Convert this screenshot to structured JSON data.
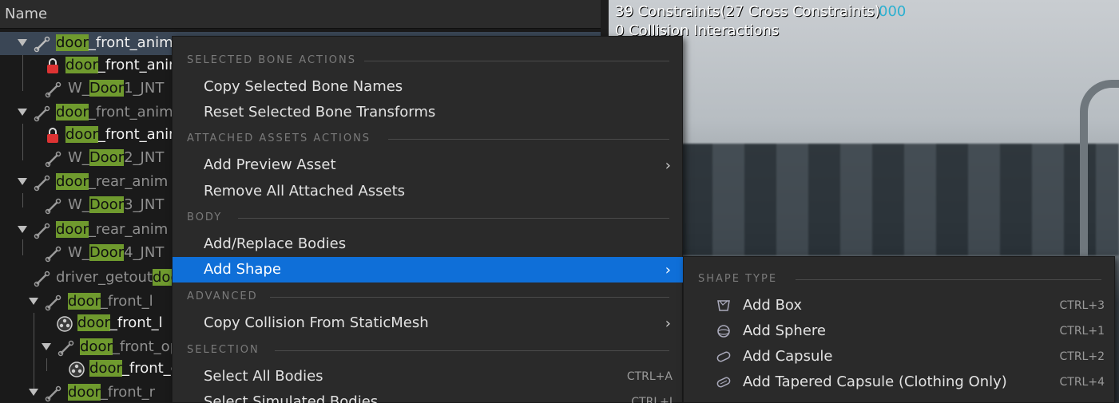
{
  "tree": {
    "header": "Name",
    "rows": [
      {
        "pre": "",
        "hl": "door",
        "post": "_front_anim",
        "icon": "bone-icon"
      },
      {
        "pre": "",
        "hl": "door",
        "post": "_front_anim",
        "icon": "lock-icon"
      },
      {
        "pre": "W_",
        "hl": "Door",
        "post": "1_JNT",
        "icon": "bone-icon"
      },
      {
        "pre": "",
        "hl": "door",
        "post": "_front_anim",
        "icon": "bone-icon"
      },
      {
        "pre": "",
        "hl": "door",
        "post": "_front_anim",
        "icon": "lock-icon"
      },
      {
        "pre": "W_",
        "hl": "Door",
        "post": "2_JNT",
        "icon": "bone-icon"
      },
      {
        "pre": "",
        "hl": "door",
        "post": "_rear_anim",
        "icon": "bone-icon"
      },
      {
        "pre": "W_",
        "hl": "Door",
        "post": "3_JNT",
        "icon": "bone-icon"
      },
      {
        "pre": "",
        "hl": "door",
        "post": "_rear_anim",
        "icon": "bone-icon"
      },
      {
        "pre": "W_",
        "hl": "Door",
        "post": "4_JNT",
        "icon": "bone-icon"
      },
      {
        "pre": "driver_getout",
        "hl": "door",
        "post": "",
        "icon": "bone-icon"
      },
      {
        "pre": "",
        "hl": "door",
        "post": "_front_l",
        "icon": "bone-icon"
      },
      {
        "pre": "",
        "hl": "door",
        "post": "_front_l",
        "icon": "body-icon"
      },
      {
        "pre": "",
        "hl": "door",
        "post": "_front_op",
        "icon": "bone-icon"
      },
      {
        "pre": "",
        "hl": "door",
        "post": "_front_c",
        "icon": "body-icon"
      },
      {
        "pre": "",
        "hl": "door",
        "post": "_front_r",
        "icon": "bone-icon"
      }
    ]
  },
  "viewport": {
    "constraints_text": "39 Constraints(27 Cross Constraints)",
    "ghost_text": "000",
    "collision_text": "0 Collision Interactions"
  },
  "menu": {
    "sections": {
      "selected_bone": "SELECTED BONE ACTIONS",
      "attached_assets": "ATTACHED ASSETS ACTIONS",
      "body": "BODY",
      "advanced": "ADVANCED",
      "selection": "SELECTION"
    },
    "items": {
      "copy_bone_names": "Copy Selected Bone Names",
      "reset_bone_transforms": "Reset Selected Bone Transforms",
      "add_preview_asset": "Add Preview Asset",
      "remove_attached": "Remove All Attached Assets",
      "add_replace_bodies": "Add/Replace Bodies",
      "add_shape": "Add Shape",
      "copy_collision": "Copy Collision From StaticMesh",
      "select_all_bodies": "Select All Bodies",
      "select_all_bodies_shortcut": "CTRL+A",
      "select_simulated": "Select Simulated Bodies",
      "select_simulated_shortcut": "CTRL+I"
    },
    "submenu_chevron": "›"
  },
  "submenu": {
    "section": "SHAPE TYPE",
    "items": [
      {
        "label": "Add Box",
        "shortcut": "CTRL+3",
        "icon": "box-shape-icon"
      },
      {
        "label": "Add Sphere",
        "shortcut": "CTRL+1",
        "icon": "sphere-shape-icon"
      },
      {
        "label": "Add Capsule",
        "shortcut": "CTRL+2",
        "icon": "capsule-shape-icon"
      },
      {
        "label": "Add Tapered Capsule (Clothing Only)",
        "shortcut": "CTRL+4",
        "icon": "tapered-capsule-icon"
      }
    ]
  },
  "colors": {
    "highlight": "#6f9a2e",
    "active_item": "#0f6fd8",
    "selected_row": "#3a4655"
  }
}
